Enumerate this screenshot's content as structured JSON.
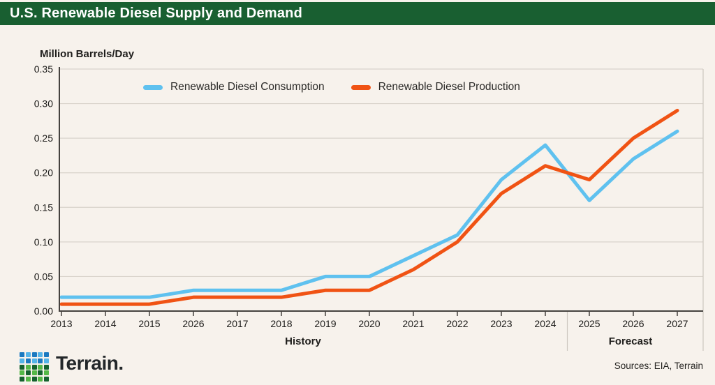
{
  "header": {
    "title": "U.S. Renewable Diesel Supply and Demand"
  },
  "chart_data": {
    "type": "line",
    "title": "U.S. Renewable Diesel Supply and Demand",
    "ylabel": "Million Barrels/Day",
    "ylim": [
      0,
      0.35
    ],
    "y_ticks": [
      "0.00",
      "0.05",
      "0.10",
      "0.15",
      "0.20",
      "0.25",
      "0.30",
      "0.35"
    ],
    "categories": [
      "2013",
      "2014",
      "2015",
      "2026",
      "2017",
      "2018",
      "2019",
      "2020",
      "2021",
      "2022",
      "2023",
      "2024",
      "2025",
      "2026",
      "2027"
    ],
    "grid": "horizontal",
    "legend_position": "top-center",
    "series": [
      {
        "name": "Renewable Diesel Consumption",
        "color": "#5fc1ef",
        "values": [
          0.02,
          0.02,
          0.02,
          0.03,
          0.03,
          0.03,
          0.05,
          0.05,
          0.08,
          0.11,
          0.19,
          0.24,
          0.16,
          0.22,
          0.26
        ]
      },
      {
        "name": "Renewable Diesel Production",
        "color": "#f05314",
        "values": [
          0.01,
          0.01,
          0.01,
          0.02,
          0.02,
          0.02,
          0.03,
          0.03,
          0.06,
          0.1,
          0.17,
          0.21,
          0.19,
          0.25,
          0.29
        ]
      }
    ],
    "sections": [
      {
        "label": "History",
        "divider_after_category_index": 11
      },
      {
        "label": "Forecast"
      }
    ]
  },
  "colors": {
    "header_background": "#195f31",
    "page_background": "#f7f2ec",
    "axis": "#45423f",
    "tick_label": "#1c1b19",
    "gridline": "#d9d3cb",
    "section_divider": "#ccc6bf",
    "consumption_line": "#5fc1ef",
    "production_line": "#f05314"
  },
  "footer": {
    "brand": "Terrain.",
    "sources": "Sources: EIA, Terrain",
    "logo_palette": {
      "blue_dark": "#1b79c0",
      "blue_light": "#55b5e9",
      "green_dark": "#15622f",
      "green_light": "#55b848"
    }
  }
}
